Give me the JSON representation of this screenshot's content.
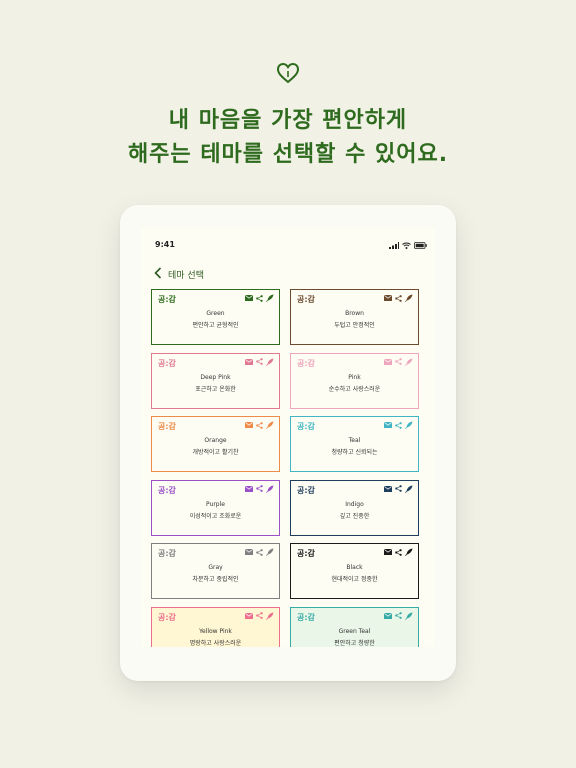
{
  "header": {
    "line1": "내 마음을 가장 편안하게",
    "line2": "해주는 테마를 선택할 수 있어요.",
    "accent": "#2f6b1e"
  },
  "device": {
    "status": {
      "time": "9:41"
    },
    "nav": {
      "back_icon": "chevron-left-icon",
      "title": "테마 선택"
    }
  },
  "themes": [
    {
      "brand": "공:감",
      "name": "Green",
      "desc": "편안하고 균형적인",
      "color": "#2e6b1e",
      "bg": "#fdfdf3"
    },
    {
      "brand": "공:감",
      "name": "Brown",
      "desc": "두텁고 안정적인",
      "color": "#6b4a2e",
      "bg": "#fdfdf3"
    },
    {
      "brand": "공:감",
      "name": "Deep Pink",
      "desc": "포근하고 온화한",
      "color": "#e07a92",
      "bg": "#fdfdf3"
    },
    {
      "brand": "공:감",
      "name": "Pink",
      "desc": "순수하고 사랑스러운",
      "color": "#efa5bb",
      "bg": "#fdfdf3"
    },
    {
      "brand": "공:감",
      "name": "Orange",
      "desc": "개방적이고 활기찬",
      "color": "#ee8a4a",
      "bg": "#fdfdf3"
    },
    {
      "brand": "공:감",
      "name": "Teal",
      "desc": "청량하고 신뢰되는",
      "color": "#41b5c4",
      "bg": "#fdfdf3"
    },
    {
      "brand": "공:감",
      "name": "Purple",
      "desc": "이성적이고 조화로운",
      "color": "#9a50c7",
      "bg": "#fdfdf3"
    },
    {
      "brand": "공:감",
      "name": "Indigo",
      "desc": "깊고 진중한",
      "color": "#1f3d5c",
      "bg": "#fdfdf3"
    },
    {
      "brand": "공:감",
      "name": "Gray",
      "desc": "차분하고 중립적인",
      "color": "#7f7f7f",
      "bg": "#fdfdf3"
    },
    {
      "brand": "공:감",
      "name": "Black",
      "desc": "현대적이고 정중한",
      "color": "#1a1a1a",
      "bg": "#fdfdf3"
    },
    {
      "brand": "공:감",
      "name": "Yellow Pink",
      "desc": "명랑하고 사랑스러운",
      "color": "#ec6f8c",
      "bg": "#fff6d3"
    },
    {
      "brand": "공:감",
      "name": "Green Teal",
      "desc": "편안하고 청량한",
      "color": "#36aaa4",
      "bg": "#eaf7e8"
    }
  ],
  "icons": [
    "heart-icon",
    "mail-icon",
    "share-icon",
    "feather-icon",
    "signal-icon",
    "wifi-icon",
    "battery-icon"
  ]
}
